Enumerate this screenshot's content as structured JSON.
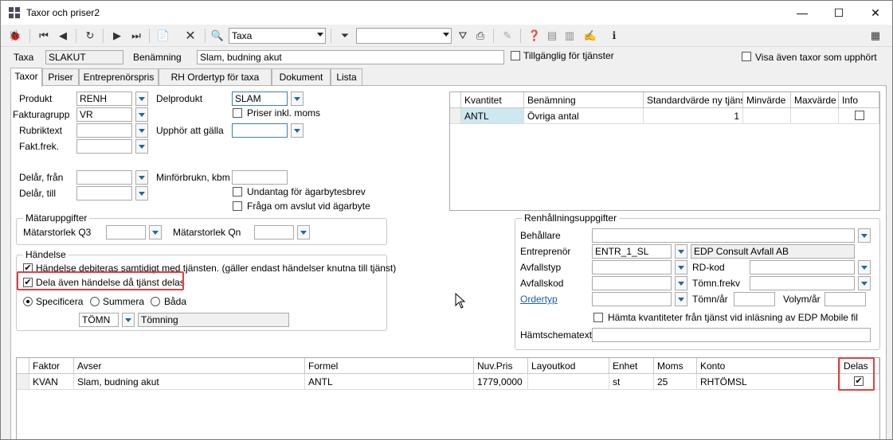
{
  "window": {
    "title": "Taxor och priser2",
    "minimize": "—",
    "maximize": "☐",
    "close": "✕"
  },
  "toolbar": {
    "search_value": "Taxa",
    "filter_value": ""
  },
  "header": {
    "taxa_label": "Taxa",
    "taxa_value": "SLAKUT",
    "benamning_label": "Benämning",
    "benamning_value": "Slam, budning akut",
    "tillganglig_label": "Tillgänglig för tjänster",
    "visa_label": "Visa även taxor som upphört"
  },
  "tabs": [
    "Taxor",
    "Priser",
    "Entreprenörspris",
    "RH Ordertyp för taxa",
    "Dokument",
    "Lista"
  ],
  "left": {
    "produkt_label": "Produkt",
    "produkt_value": "RENH",
    "fakturagrupp_label": "Fakturagrupp",
    "fakturagrupp_value": "VR",
    "rubriktext_label": "Rubriktext",
    "rubriktext_value": "",
    "faktfrek_label": "Fakt.frek.",
    "faktfrek_value": "",
    "delprodukt_label": "Delprodukt",
    "delprodukt_value": "SLAM",
    "priser_inkl_label": "Priser inkl. moms",
    "upphor_label": "Upphör att gälla",
    "upphor_value": "",
    "delar_fran_label": "Delår, från",
    "delar_till_label": "Delår, till",
    "minforbrukn_label": "Minförbrukn, kbm",
    "undantag_label": "Undantag för ägarbytesbrev",
    "fraga_label": "Fråga om avslut vid ägarbyte"
  },
  "matar": {
    "title": "Mätaruppgifter",
    "q3_label": "Mätarstorlek Q3",
    "qn_label": "Mätarstorlek Qn"
  },
  "handelse": {
    "title": "Händelse",
    "debiteras_label": "Händelse debiteras samtidigt med tjänsten. (gäller endast händelser knutna till tjänst)",
    "dela_label": "Dela även händelse då tjänst delas",
    "specificera_label": "Specificera",
    "summera_label": "Summera",
    "bada_label": "Båda",
    "code_value": "TÖMN",
    "desc_value": "Tömning",
    "debiteras_check": "✔",
    "dela_check": "✔"
  },
  "kvantitet_grid": {
    "headers": [
      "Kvantitet",
      "Benämning",
      "Standardvärde ny tjänst",
      "Minvärde",
      "Maxvärde",
      "Info"
    ],
    "row": [
      "ANTL",
      "Övriga antal",
      "1",
      "",
      "",
      ""
    ]
  },
  "renhall": {
    "title": "Renhållningsuppgifter",
    "behallare_label": "Behållare",
    "behallare_value": "",
    "entreprenor_label": "Entreprenör",
    "entreprenor_value": "ENTR_1_SL",
    "entreprenor_name": "EDP Consult Avfall AB",
    "avfallstyp_label": "Avfallstyp",
    "rdkod_label": "RD-kod",
    "avfallskod_label": "Avfallskod",
    "tomnfrekv_label": "Tömn.frekv",
    "ordertyp_label": "Ordertyp",
    "tomnar_label": "Tömn/år",
    "volymar_label": "Volym/år",
    "hamta_label": "Hämta kvantiteter från tjänst vid inläsning av EDP Mobile fil",
    "hamtschema_label": "Hämtschematext"
  },
  "bottom_grid": {
    "headers": [
      "Faktor",
      "Avser",
      "Formel",
      "Nuv.Pris",
      "Layoutkod",
      "Enhet",
      "Moms",
      "Konto",
      "Delas"
    ],
    "row": [
      "KVAN",
      "Slam, budning akut",
      "ANTL",
      "1779,0000",
      "",
      "st",
      "25",
      "RHTÖMSL",
      "✔"
    ]
  },
  "colors": {
    "selected_cell": "#cde8f0",
    "highlight": "#e04040",
    "dropdown_arrow": "#1a6aa0"
  }
}
